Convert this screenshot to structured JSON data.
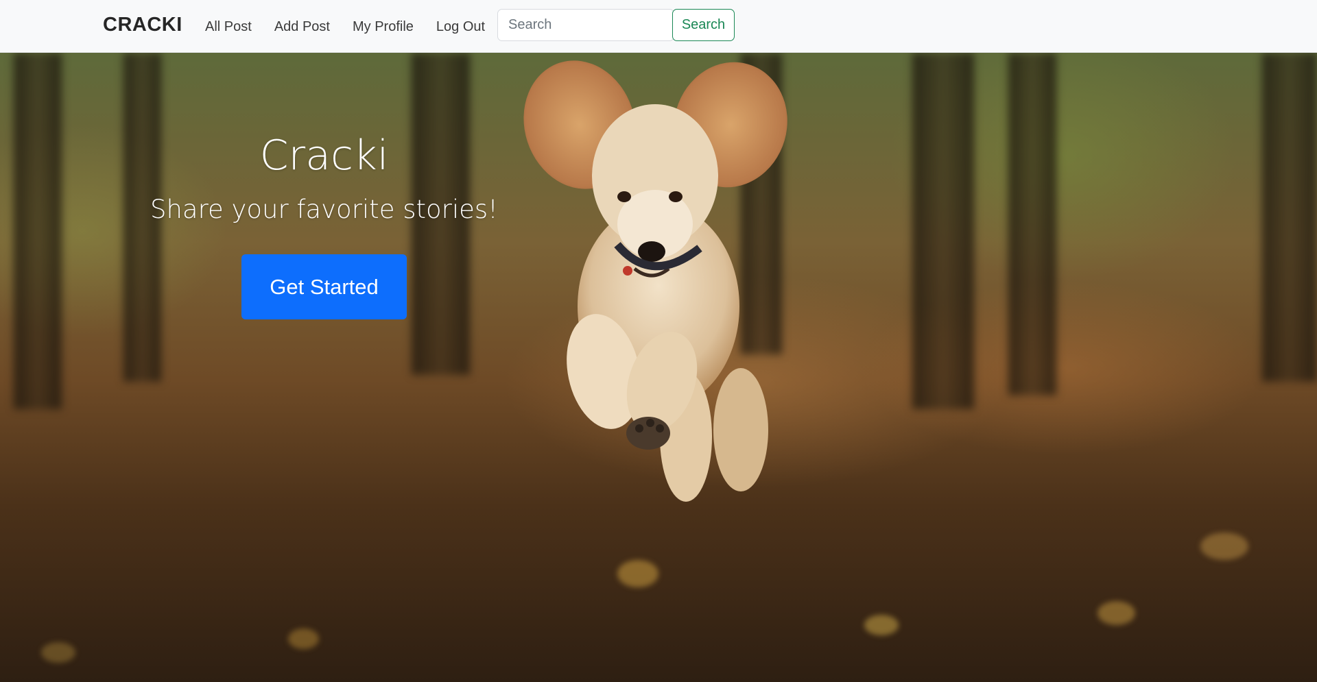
{
  "navbar": {
    "brand": "CRACKI",
    "links": [
      "All Post",
      "Add Post",
      "My Profile",
      "Log Out"
    ],
    "search_placeholder": "Search",
    "search_button": "Search"
  },
  "hero": {
    "title": "Cracki",
    "subtitle": "Share your favorite stories!",
    "cta_label": "Get Started",
    "background_image": "dog-running-in-forest"
  },
  "colors": {
    "navbar_bg": "#f8f9fa",
    "search_button": "#198754",
    "cta_button": "#0d6efd"
  }
}
